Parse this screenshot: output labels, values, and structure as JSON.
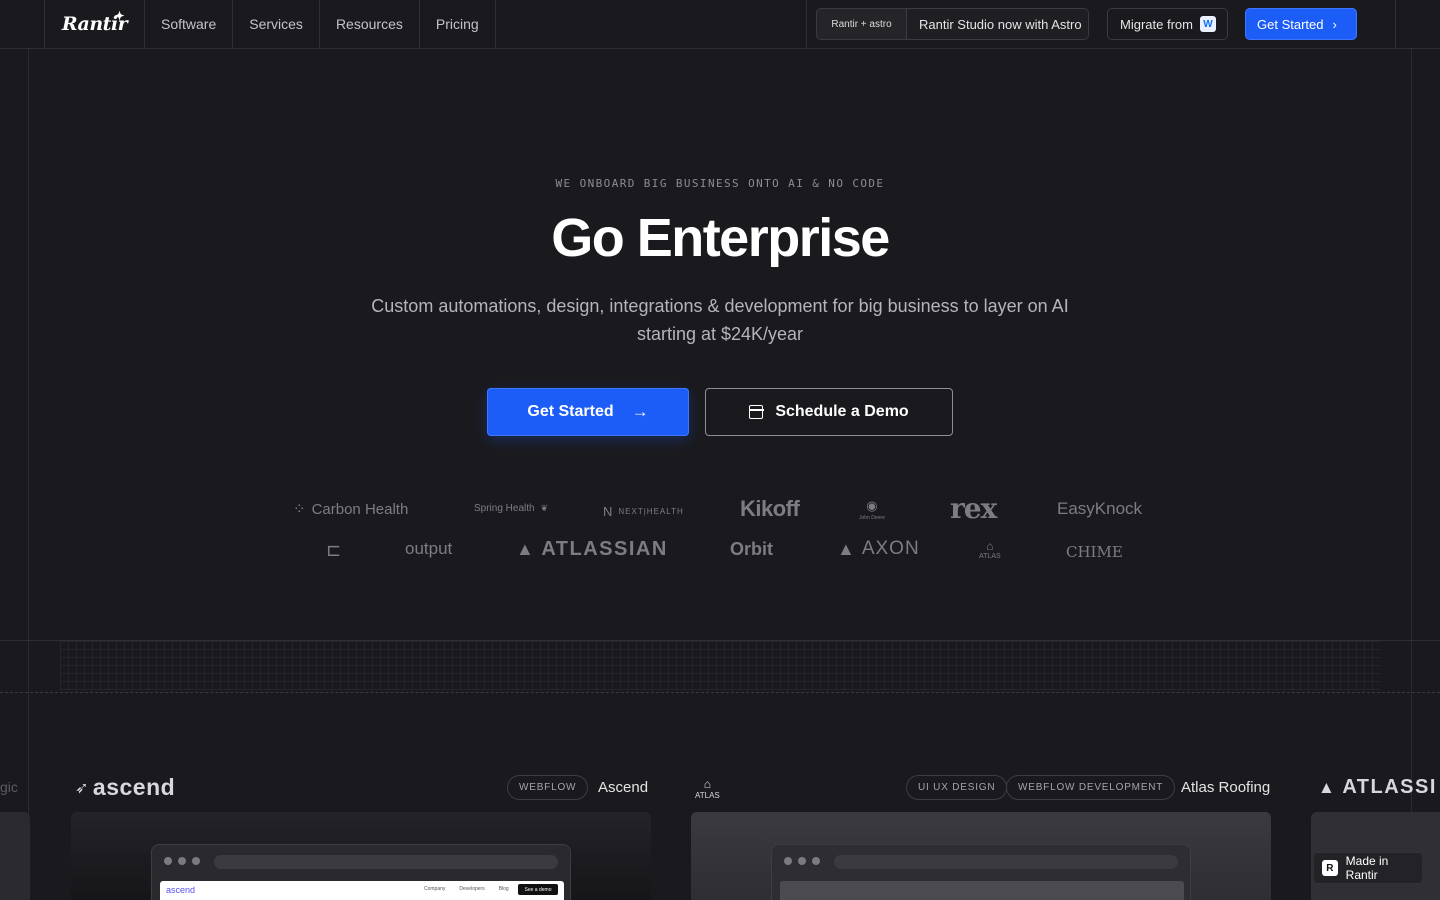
{
  "nav": {
    "logo": "Rantir",
    "links": [
      "Software",
      "Services",
      "Resources",
      "Pricing"
    ],
    "announcement_badge": "Rantir + astro",
    "announcement_text": "Rantir Studio now with Astro",
    "migrate_label": "Migrate from",
    "cta_label": "Get Started"
  },
  "hero": {
    "eyebrow": "WE ONBOARD BIG BUSINESS ONTO AI & NO CODE",
    "title": "Go Enterprise",
    "subtitle": "Custom automations, design, integrations & development for big business to layer on AI starting at $24K/year",
    "primary_cta": "Get Started",
    "secondary_cta": "Schedule a Demo"
  },
  "logos": {
    "row1": [
      "Carbon Health",
      "Spring Health",
      "NEXT|HEALTH",
      "Kikoff",
      "John Deere",
      "rex",
      "EasyKnock"
    ],
    "row2": [
      "",
      "output",
      "ATLASSIAN",
      "Orbit",
      "AXON",
      "ATLAS",
      "CHIME"
    ]
  },
  "cases": [
    {
      "brand": "ascend",
      "tags": [
        "WEBFLOW"
      ],
      "name": "Ascend"
    },
    {
      "brand": "ATLAS",
      "tags": [
        "UI UX DESIGN",
        "WEBFLOW DEVELOPMENT"
      ],
      "name": "Atlas Roofing"
    },
    {
      "brand": "ATLASSI",
      "tags": [],
      "name": ""
    }
  ],
  "mini_page": {
    "logo": "ascend",
    "nav": [
      "Company",
      "Developers",
      "Blog"
    ],
    "button": "See a demo"
  },
  "edge_text": "gic",
  "made_in": "Made in Rantir",
  "colors": {
    "background": "#1a1a1e",
    "accent": "#1c5cf7",
    "text": "#ffffff",
    "muted": "#8c8c92"
  }
}
